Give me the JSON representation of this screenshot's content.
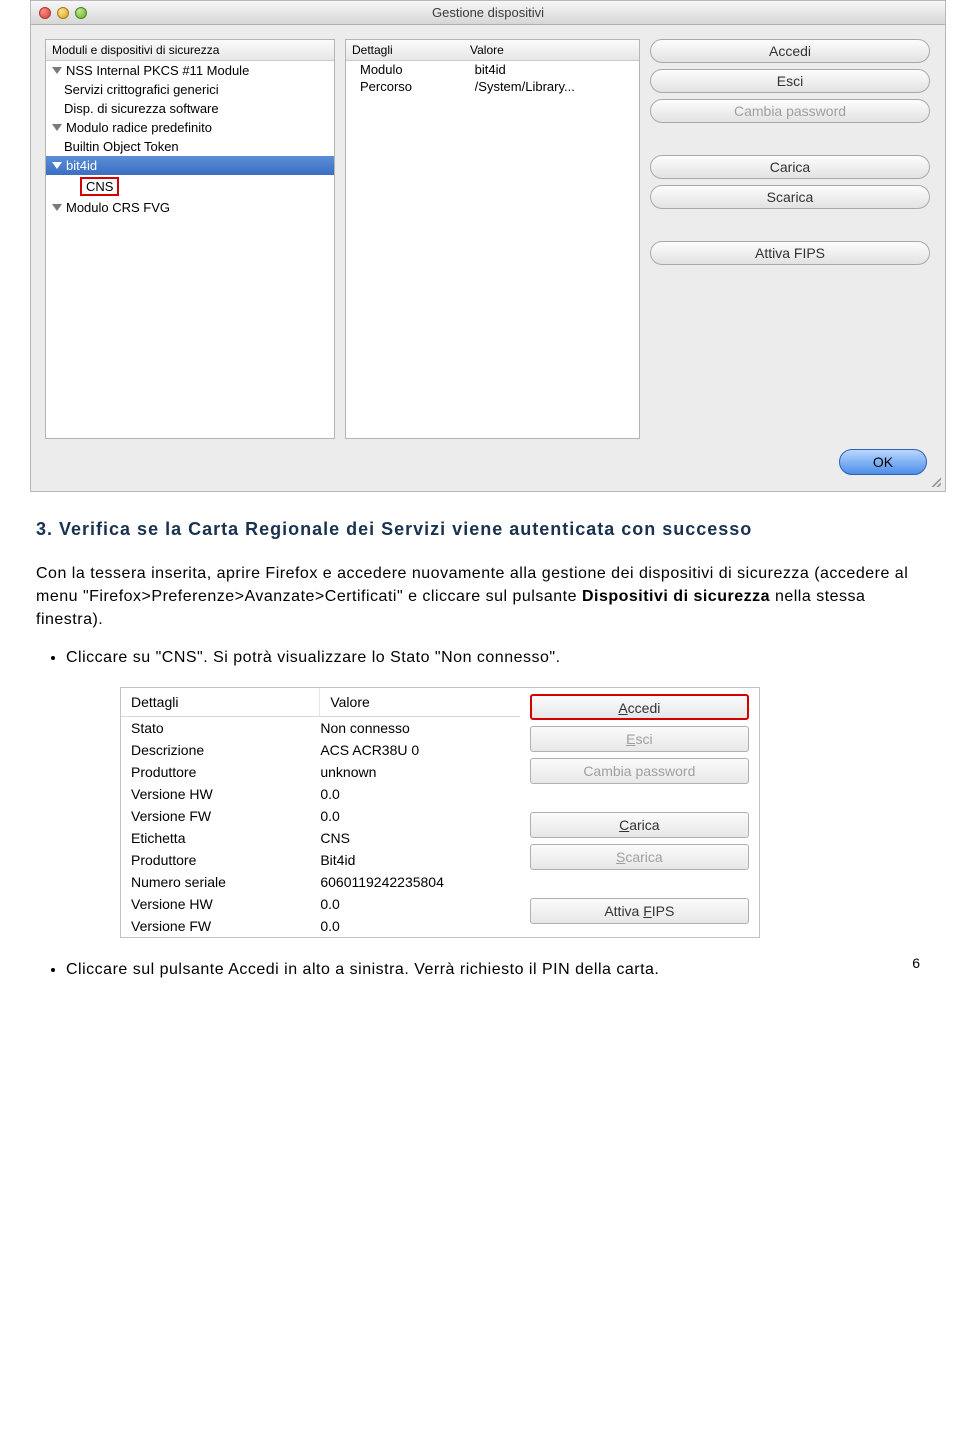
{
  "dialog1": {
    "title": "Gestione dispositivi",
    "tree_header": "Moduli e dispositivi di sicurezza",
    "tree": [
      {
        "label": "NSS Internal PKCS #11 Module",
        "level": 0,
        "expand": true
      },
      {
        "label": "Servizi crittografici generici",
        "level": 1
      },
      {
        "label": "Disp. di sicurezza software",
        "level": 1
      },
      {
        "label": "Modulo radice predefinito",
        "level": 0,
        "expand": true
      },
      {
        "label": "Builtin Object Token",
        "level": 1
      },
      {
        "label": "bit4id",
        "level": 0,
        "expand": true,
        "selected": true
      },
      {
        "label": "CNS",
        "level": 2,
        "highlight": true
      },
      {
        "label": "Modulo CRS FVG",
        "level": 0,
        "expand": true
      }
    ],
    "details_header": {
      "c1": "Dettagli",
      "c2": "Valore"
    },
    "details": [
      {
        "k": "Modulo",
        "v": "bit4id"
      },
      {
        "k": "Percorso",
        "v": "/System/Library..."
      }
    ],
    "buttons": [
      "Accedi",
      "Esci",
      "Cambia password",
      "Carica",
      "Scarica",
      "Attiva FIPS"
    ],
    "disabled_buttons": [
      "Cambia password"
    ],
    "ok_label": "OK"
  },
  "section": {
    "heading": "3. Verifica se la Carta Regionale dei Servizi viene autenticata con successo",
    "paragraph": "Con la tessera inserita, aprire Firefox e accedere nuovamente alla gestione dei dispositivi di sicurezza (accedere al menu \"Firefox>Preferenze>Avanzate>Certificati\" e cliccare sul pulsante ",
    "paragraph_bold": "Dispositivi di sicurezza",
    "paragraph_tail": " nella stessa finestra).",
    "bullet1": "Cliccare su \"CNS\". Si potrà visualizzare lo Stato \"Non connesso\".",
    "bullet2": "Cliccare sul pulsante Accedi in alto a sinistra. Verrà richiesto il PIN della carta."
  },
  "dialog2": {
    "header": {
      "c1": "Dettagli",
      "c2": "Valore"
    },
    "rows": [
      {
        "k": "Stato",
        "v": "Non connesso"
      },
      {
        "k": "Descrizione",
        "v": "ACS ACR38U 0"
      },
      {
        "k": "Produttore",
        "v": "unknown"
      },
      {
        "k": "Versione HW",
        "v": "0.0"
      },
      {
        "k": "Versione FW",
        "v": "0.0"
      },
      {
        "k": "Etichetta",
        "v": "CNS"
      },
      {
        "k": "Produttore",
        "v": "Bit4id"
      },
      {
        "k": "Numero seriale",
        "v": "6060119242235804"
      },
      {
        "k": "Versione HW",
        "v": "0.0"
      },
      {
        "k": "Versione FW",
        "v": "0.0"
      }
    ],
    "buttons": [
      {
        "label": "Accedi",
        "hl": true,
        "underline": "A"
      },
      {
        "label": "Esci",
        "disabled": true,
        "underline": "E"
      },
      {
        "label": "Cambia password",
        "disabled": true
      },
      {
        "label": "Carica",
        "underline": "C"
      },
      {
        "label": "Scarica",
        "disabled": true,
        "underline": "S"
      },
      {
        "label": "Attiva FIPS",
        "underline": "F"
      }
    ]
  },
  "page_number": "6"
}
